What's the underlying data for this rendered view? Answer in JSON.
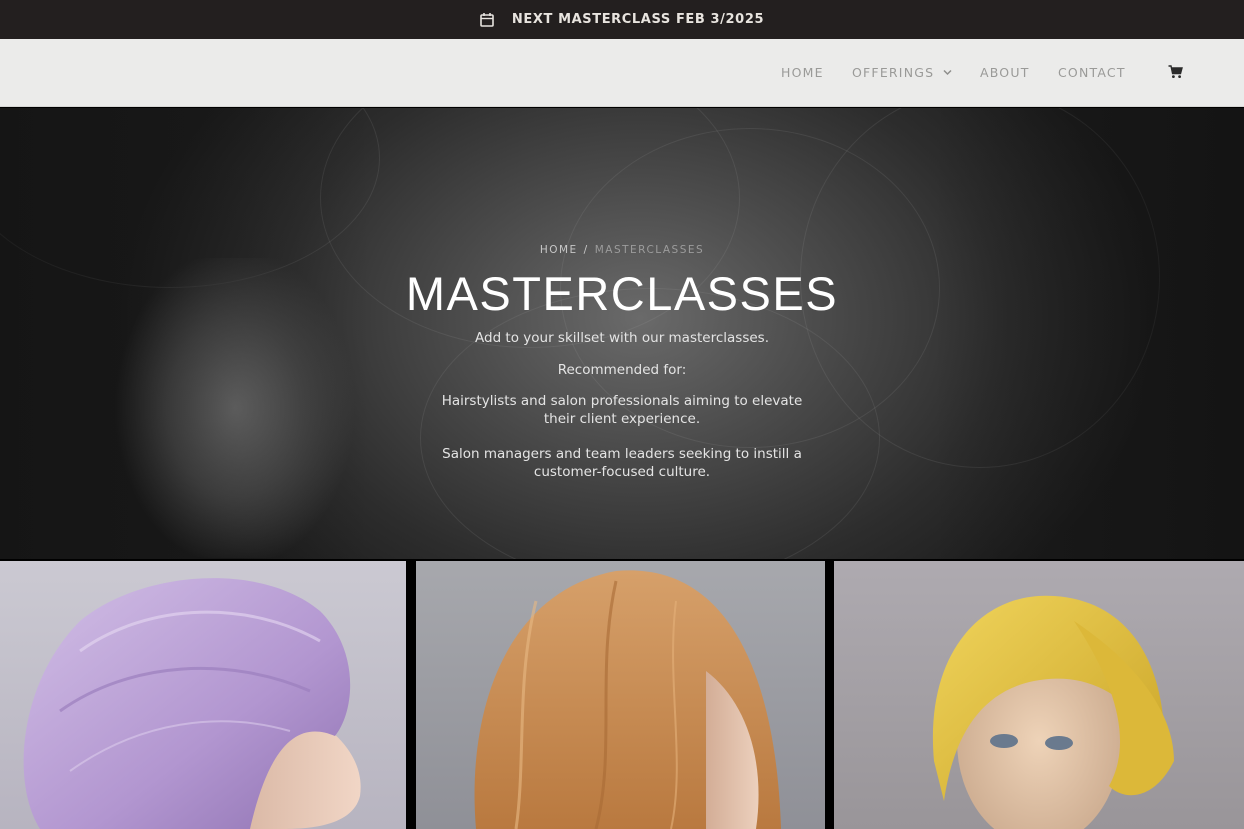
{
  "announcement": {
    "icon": "calendar-icon",
    "text": "NEXT MASTERCLASS FEB 3/2025"
  },
  "nav": {
    "items": [
      {
        "label": "HOME"
      },
      {
        "label": "OFFERINGS",
        "has_dropdown": true
      },
      {
        "label": "ABOUT"
      },
      {
        "label": "CONTACT"
      }
    ],
    "cart_icon": "cart-icon"
  },
  "hero": {
    "breadcrumb": {
      "home": "HOME",
      "separator": "/",
      "current": "MASTERCLASSES"
    },
    "title": "MASTERCLASSES",
    "intro": "Add to your skillset with our masterclasses.",
    "recommended_heading": "Recommended for:",
    "audience_1_line_1": "Hairstylists and salon professionals aiming to elevate",
    "audience_1_line_2": "their client experience.",
    "audience_2_line_1": "Salon managers and team leaders seeking to instill a",
    "audience_2_line_2": "customer-focused culture."
  },
  "colors": {
    "announce_bg": "#231f1f",
    "header_bg": "#ebebea",
    "nav_text": "#9a9a98",
    "wig_lavender": "#b89fd3",
    "wig_copper": "#c98b55",
    "wig_blonde": "#e0bf3a"
  }
}
